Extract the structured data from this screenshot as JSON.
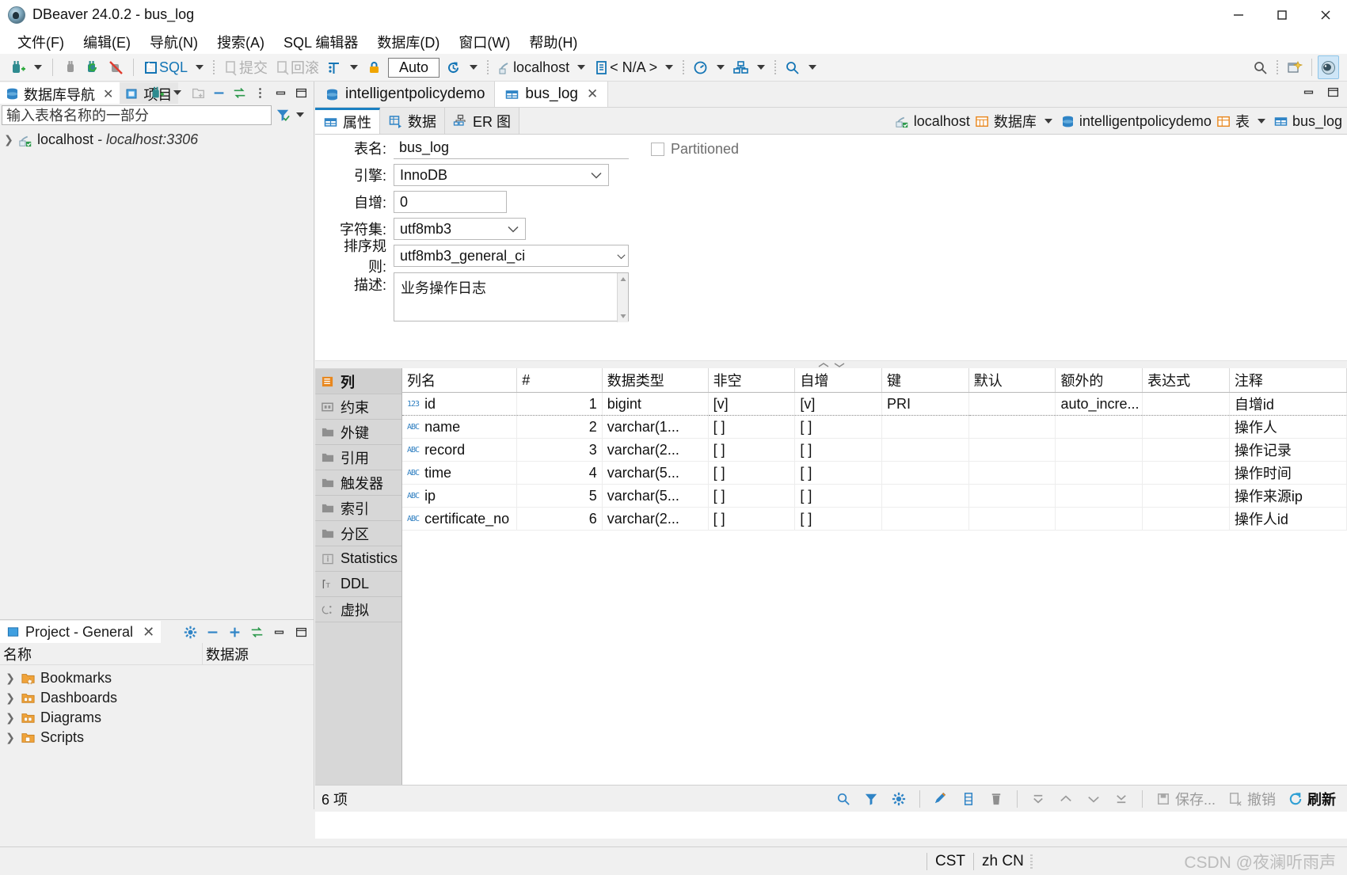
{
  "window": {
    "title": "DBeaver 24.0.2 - bus_log",
    "minimize": "minimize-icon",
    "maximize": "maximize-icon",
    "close": "close-icon"
  },
  "menubar": {
    "items": [
      {
        "label": "文件(F)"
      },
      {
        "label": "编辑(E)"
      },
      {
        "label": "导航(N)"
      },
      {
        "label": "搜索(A)"
      },
      {
        "label": "SQL 编辑器"
      },
      {
        "label": "数据库(D)"
      },
      {
        "label": "窗口(W)"
      },
      {
        "label": "帮助(H)"
      }
    ]
  },
  "toolbar": {
    "sql_label": "SQL",
    "commit_label": "提交",
    "rollback_label": "回滚",
    "auto_label": "Auto",
    "connection": "localhost",
    "database": "< N/A >"
  },
  "navigator": {
    "tabs": [
      {
        "label": "数据库导航",
        "icon": "database-icon",
        "active": true,
        "closable": true
      },
      {
        "label": "项目",
        "icon": "project-icon",
        "active": false,
        "closable": false
      }
    ],
    "filter_placeholder": "输入表格名称的一部分",
    "tree": [
      {
        "label": "localhost",
        "detail": "- localhost:3306"
      }
    ]
  },
  "project_panel": {
    "title": "Project - General",
    "columns": [
      "名称",
      "数据源"
    ],
    "rows": [
      {
        "label": "Bookmarks",
        "icon": "bookmark-folder-icon"
      },
      {
        "label": "Dashboards",
        "icon": "dashboard-folder-icon"
      },
      {
        "label": "Diagrams",
        "icon": "diagram-folder-icon"
      },
      {
        "label": "Scripts",
        "icon": "script-folder-icon"
      }
    ]
  },
  "editor": {
    "tabs": [
      {
        "label": "intelligentpolicydemo",
        "icon": "database-icon",
        "active": false,
        "closable": false
      },
      {
        "label": "bus_log",
        "icon": "table-icon",
        "active": true,
        "closable": true
      }
    ],
    "subtabs": [
      {
        "label": "属性",
        "icon": "properties-icon",
        "active": true
      },
      {
        "label": "数据",
        "icon": "data-grid-icon",
        "active": false
      },
      {
        "label": "ER 图",
        "icon": "er-diagram-icon",
        "active": false
      }
    ],
    "breadcrumb": [
      {
        "label": "localhost",
        "icon": "connection-icon",
        "caret": false
      },
      {
        "label": "数据库",
        "icon": "databases-icon",
        "caret": true
      },
      {
        "label": "intelligentpolicydemo",
        "icon": "database-icon",
        "caret": false
      },
      {
        "label": "表",
        "icon": "tables-icon",
        "caret": true
      },
      {
        "label": "bus_log",
        "icon": "table-icon",
        "caret": false
      }
    ]
  },
  "properties": {
    "fields": [
      {
        "label": "表名:",
        "value": "bus_log",
        "type": "text"
      },
      {
        "label": "引擎:",
        "value": "InnoDB",
        "type": "combo"
      },
      {
        "label": "自增:",
        "value": "0",
        "type": "text"
      },
      {
        "label": "字符集:",
        "value": "utf8mb3",
        "type": "combo"
      },
      {
        "label": "排序规则:",
        "value": "utf8mb3_general_ci",
        "type": "combo"
      },
      {
        "label": "描述:",
        "value": "业务操作日志",
        "type": "textarea"
      }
    ],
    "partitioned_label": "Partitioned",
    "partitioned_checked": false
  },
  "object_nav": {
    "items": [
      {
        "label": "列",
        "icon": "columns-icon",
        "active": true
      },
      {
        "label": "约束",
        "icon": "constraint-icon",
        "active": false
      },
      {
        "label": "外键",
        "icon": "folder-icon",
        "active": false
      },
      {
        "label": "引用",
        "icon": "folder-icon",
        "active": false
      },
      {
        "label": "触发器",
        "icon": "folder-icon",
        "active": false
      },
      {
        "label": "索引",
        "icon": "folder-icon",
        "active": false
      },
      {
        "label": "分区",
        "icon": "folder-icon",
        "active": false
      },
      {
        "label": "Statistics",
        "icon": "info-icon",
        "active": false
      },
      {
        "label": "DDL",
        "icon": "ddl-icon",
        "active": false
      },
      {
        "label": "虚拟",
        "icon": "virtual-icon",
        "active": false
      }
    ]
  },
  "columns_grid": {
    "headers": [
      "列名",
      "#",
      "数据类型",
      "非空",
      "自增",
      "键",
      "默认",
      "额外的",
      "表达式",
      "注释"
    ],
    "rows": [
      {
        "selected": true,
        "icon": "number-type-icon",
        "name": "id",
        "num": "1",
        "datatype": "bigint",
        "not_null": "[v]",
        "auto_increment": "[v]",
        "key": "PRI",
        "default": "",
        "extra": "auto_incre...",
        "expression": "",
        "comment": "自增id"
      },
      {
        "selected": false,
        "icon": "string-type-icon",
        "name": "name",
        "num": "2",
        "datatype": "varchar(1...",
        "not_null": "[ ]",
        "auto_increment": "[ ]",
        "key": "",
        "default": "",
        "extra": "",
        "expression": "",
        "comment": "操作人"
      },
      {
        "selected": false,
        "icon": "string-type-icon",
        "name": "record",
        "num": "3",
        "datatype": "varchar(2...",
        "not_null": "[ ]",
        "auto_increment": "[ ]",
        "key": "",
        "default": "",
        "extra": "",
        "expression": "",
        "comment": "操作记录"
      },
      {
        "selected": false,
        "icon": "string-type-icon",
        "name": "time",
        "num": "4",
        "datatype": "varchar(5...",
        "not_null": "[ ]",
        "auto_increment": "[ ]",
        "key": "",
        "default": "",
        "extra": "",
        "expression": "",
        "comment": "操作时间"
      },
      {
        "selected": false,
        "icon": "string-type-icon",
        "name": "ip",
        "num": "5",
        "datatype": "varchar(5...",
        "not_null": "[ ]",
        "auto_increment": "[ ]",
        "key": "",
        "default": "",
        "extra": "",
        "expression": "",
        "comment": "操作来源ip"
      },
      {
        "selected": false,
        "icon": "string-type-icon",
        "name": "certificate_no",
        "num": "6",
        "datatype": "varchar(2...",
        "not_null": "[ ]",
        "auto_increment": "[ ]",
        "key": "",
        "default": "",
        "extra": "",
        "expression": "",
        "comment": "操作人id"
      }
    ]
  },
  "grid_toolbar": {
    "count_label": "6 项",
    "save_label": "保存...",
    "undo_label": "撤销",
    "refresh_label": "刷新"
  },
  "statusbar": {
    "timezone": "CST",
    "locale": "zh CN",
    "watermark": "CSDN @夜澜听雨声"
  },
  "colors": {
    "accent_blue": "#1a7fc1",
    "icon_orange": "#e8871e",
    "selection_border": "#8a8a8a"
  }
}
